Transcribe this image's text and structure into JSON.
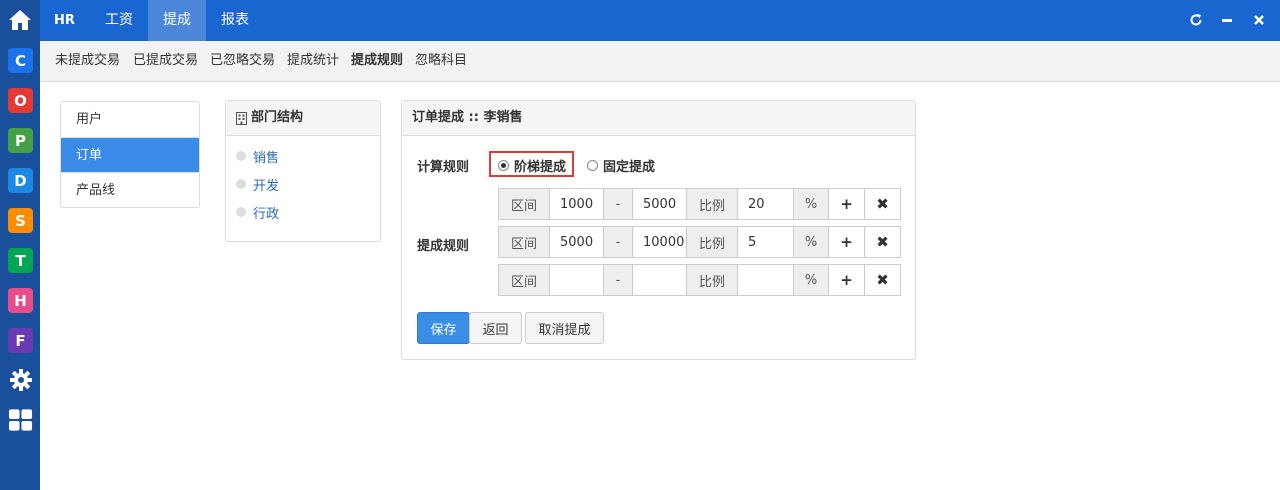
{
  "dock": {
    "apps": [
      {
        "letter": "C",
        "color": "#1a73e8"
      },
      {
        "letter": "O",
        "color": "#e53935"
      },
      {
        "letter": "P",
        "color": "#43a047"
      },
      {
        "letter": "D",
        "color": "#1e88e5"
      },
      {
        "letter": "S",
        "color": "#fb8c00"
      },
      {
        "letter": "T",
        "color": "#00a651"
      },
      {
        "letter": "H",
        "color": "#e84c8b"
      },
      {
        "letter": "F",
        "color": "#6a3ab2"
      }
    ]
  },
  "topbar": {
    "brand": "HR",
    "tabs": [
      "工资",
      "提成",
      "报表"
    ],
    "active_tab": "提成"
  },
  "subnav": {
    "items": [
      "未提成交易",
      "已提成交易",
      "已忽略交易",
      "提成统计",
      "提成规则",
      "忽略科目"
    ],
    "active": "提成规则"
  },
  "side_list": {
    "items": [
      "用户",
      "订单",
      "产品线"
    ],
    "active": "订单"
  },
  "dept": {
    "title": "部门结构",
    "items": [
      "销售",
      "开发",
      "行政"
    ]
  },
  "main": {
    "title": "订单提成 :: 李销售",
    "calc_label": "计算规则",
    "radio_tiered": "阶梯提成",
    "radio_fixed": "固定提成",
    "selected": "阶梯提成",
    "rule_label": "提成规则",
    "range_label": "区间",
    "dash": "-",
    "ratio_label": "比例",
    "percent": "%",
    "add_symbol": "+",
    "remove_symbol": "✖",
    "rules": [
      {
        "from": "1000",
        "to": "5000",
        "ratio": "20"
      },
      {
        "from": "5000",
        "to": "10000",
        "ratio": "5"
      },
      {
        "from": "",
        "to": "",
        "ratio": ""
      }
    ],
    "save": "保存",
    "back": "返回",
    "cancel": "取消提成"
  },
  "colors": {
    "dock_bg": "#1a4f9c",
    "topbar_bg": "#1a66d1",
    "primary": "#3a8ee6",
    "highlight_border": "#e03a3a"
  }
}
